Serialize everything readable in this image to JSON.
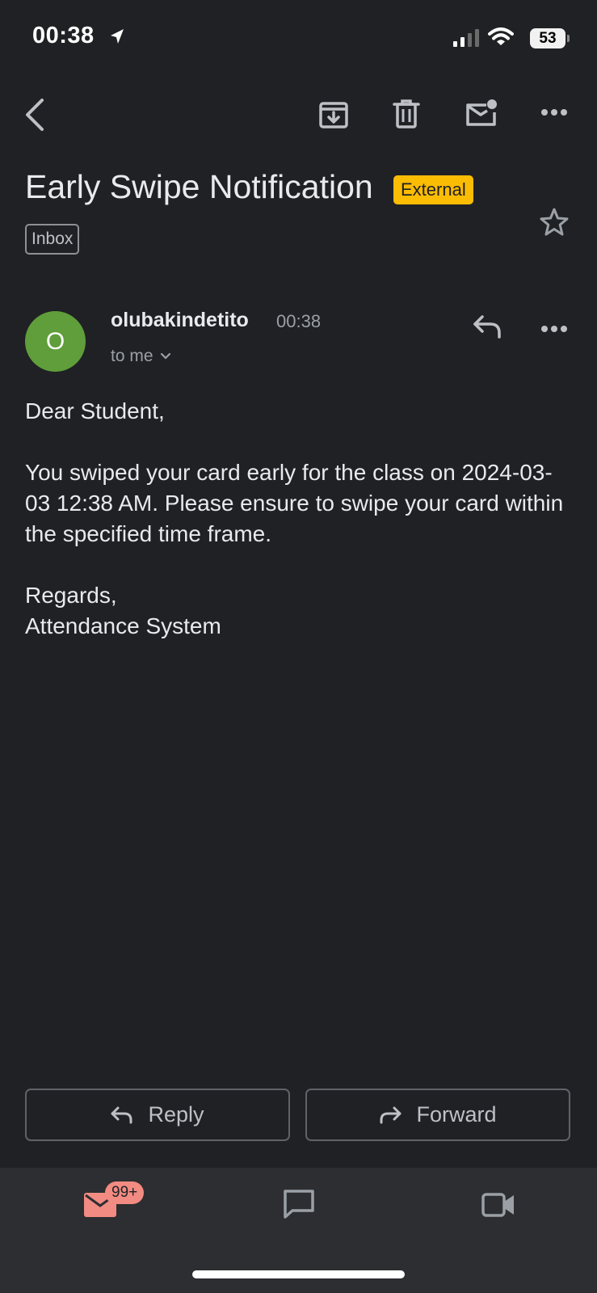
{
  "status_bar": {
    "time": "00:38",
    "battery": "53"
  },
  "toolbar": {
    "back_icon": "chevron-left-icon",
    "archive_icon": "archive-icon",
    "delete_icon": "trash-icon",
    "mark_unread_icon": "mail-unread-icon",
    "more_icon": "more-horizontal-icon"
  },
  "email": {
    "subject": "Early Swipe Notification",
    "external_label": "External",
    "folder_label": "Inbox",
    "sender": {
      "avatar_letter": "O",
      "name": "olubakindetito",
      "time": "00:38",
      "recipient": "to me"
    },
    "body": {
      "greeting": "Dear Student,",
      "message": "You swiped your card early for the class on 2024-03-03 12:38 AM. Please ensure to swipe your card within the specified time frame.",
      "closing": "Regards,",
      "signature": "Attendance System"
    }
  },
  "actions": {
    "reply_label": "Reply",
    "forward_label": "Forward"
  },
  "bottom_nav": {
    "mail_badge": "99+",
    "tabs": [
      "mail",
      "chat",
      "meet"
    ]
  },
  "colors": {
    "background": "#202124",
    "external_badge": "#fbbc04",
    "avatar": "#5f9e3a",
    "mail_accent": "#f28b82"
  }
}
